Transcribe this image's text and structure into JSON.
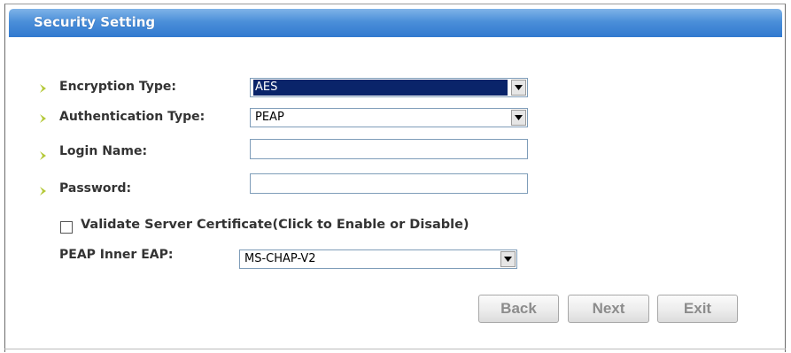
{
  "header": {
    "title": "Security Setting"
  },
  "form": {
    "encryption": {
      "label": "Encryption Type:",
      "value": "AES"
    },
    "authentication": {
      "label": "Authentication Type:",
      "value": "PEAP"
    },
    "login": {
      "label": "Login Name:",
      "value": ""
    },
    "password": {
      "label": "Password:",
      "value": ""
    },
    "validate": {
      "label": "Validate Server Certificate(Click to Enable or Disable)",
      "checked": false
    },
    "peap_inner": {
      "label": "PEAP Inner EAP:",
      "value": "MS-CHAP-V2"
    }
  },
  "buttons": {
    "back": "Back",
    "next": "Next",
    "exit": "Exit"
  },
  "colors": {
    "title_bar": "#3179cf",
    "bullet": "#b5c93a",
    "selection": "#0a246a"
  }
}
